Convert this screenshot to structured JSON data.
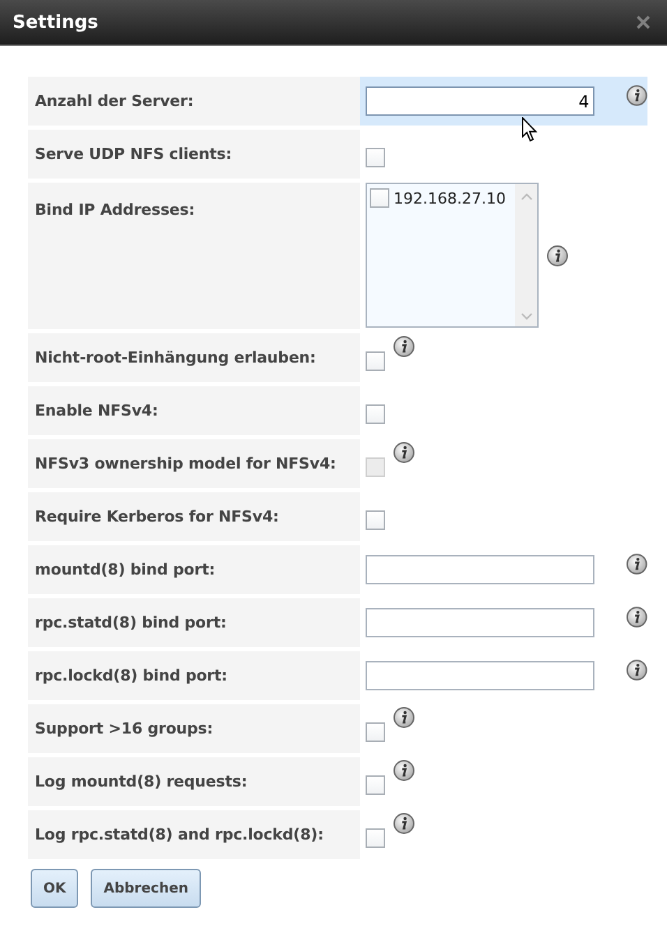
{
  "window": {
    "title": "Settings"
  },
  "rows": [
    {
      "kind": "text",
      "label": "Anzahl der Server:",
      "value": "4",
      "info": true,
      "highlighted": true
    },
    {
      "kind": "checkbox",
      "label": "Serve UDP NFS clients:",
      "checked": false,
      "disabled": false,
      "info": false,
      "highlighted": false
    },
    {
      "kind": "listbox",
      "label": "Bind IP Addresses:",
      "options": [
        {
          "label": "192.168.27.10",
          "checked": false
        }
      ],
      "info": true,
      "highlighted": false
    },
    {
      "kind": "checkbox",
      "label": "Nicht-root-Einhängung erlauben:",
      "checked": false,
      "disabled": false,
      "info": true,
      "highlighted": false
    },
    {
      "kind": "checkbox",
      "label": "Enable NFSv4:",
      "checked": false,
      "disabled": false,
      "info": false,
      "highlighted": false
    },
    {
      "kind": "checkbox",
      "label": "NFSv3 ownership model for NFSv4:",
      "checked": false,
      "disabled": true,
      "info": true,
      "highlighted": false
    },
    {
      "kind": "checkbox",
      "label": "Require Kerberos for NFSv4:",
      "checked": false,
      "disabled": false,
      "info": false,
      "highlighted": false
    },
    {
      "kind": "text",
      "label": "mountd(8) bind port:",
      "value": "",
      "info": true,
      "highlighted": false
    },
    {
      "kind": "text",
      "label": "rpc.statd(8) bind port:",
      "value": "",
      "info": true,
      "highlighted": false
    },
    {
      "kind": "text",
      "label": "rpc.lockd(8) bind port:",
      "value": "",
      "info": true,
      "highlighted": false
    },
    {
      "kind": "checkbox",
      "label": "Support >16 groups:",
      "checked": false,
      "disabled": false,
      "info": true,
      "highlighted": false
    },
    {
      "kind": "checkbox",
      "label": "Log mountd(8) requests:",
      "checked": false,
      "disabled": false,
      "info": true,
      "highlighted": false
    },
    {
      "kind": "checkbox",
      "label": "Log rpc.statd(8) and rpc.lockd(8):",
      "checked": false,
      "disabled": false,
      "info": true,
      "highlighted": false
    }
  ],
  "buttons": [
    "OK",
    "Abbrechen"
  ]
}
